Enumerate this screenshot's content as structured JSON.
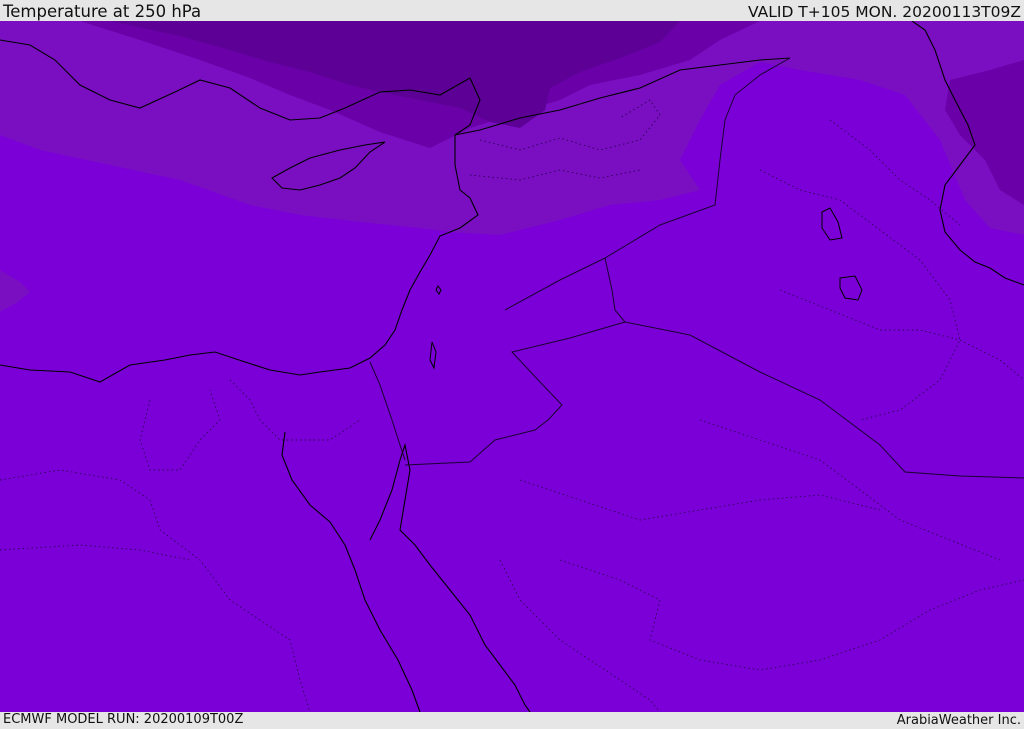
{
  "header": {
    "title": "Temperature at 250 hPa",
    "valid_time": "VALID T+105 MON. 20200113T09Z"
  },
  "footer": {
    "model_run": "ECMWF MODEL RUN: 20200109T00Z",
    "credit": "ArabiaWeather Inc."
  },
  "map": {
    "colors": {
      "base_fill": "#7b00d8",
      "band_1": "#7a0fc2",
      "band_2": "#6a00a8",
      "band_3": "#5c0096",
      "coastline": "#000000",
      "border": "#1a0030"
    }
  }
}
